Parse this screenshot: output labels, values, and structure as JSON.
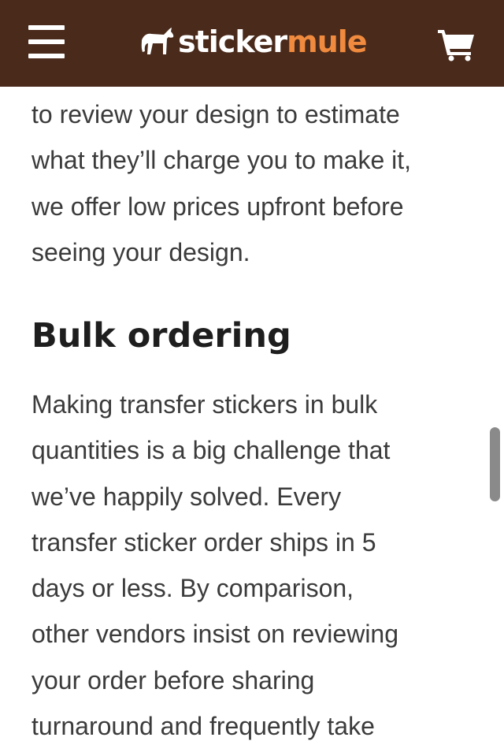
{
  "header": {
    "logo": {
      "part1": "sticker",
      "part2": "mule",
      "color_part1": "#ffffff",
      "color_part2": "#f08a3e"
    },
    "background": "#4a2a1b",
    "icons": {
      "menu": "hamburger-menu-icon",
      "cart": "shopping-cart-icon",
      "logo": "mule-icon"
    }
  },
  "content": {
    "intro_lines": [
      "to review your design to estimate",
      "what they’ll charge you to make it,",
      "we offer low prices upfront before",
      "seeing your design."
    ],
    "heading": "Bulk ordering",
    "body_lines": [
      "Making transfer stickers in bulk",
      "quantities is a big challenge that",
      "we’ve happily solved. Every",
      "transfer sticker order ships in 5",
      "days or less. By comparison,",
      "other vendors insist on reviewing",
      "your order before sharing",
      "turnaround and frequently take"
    ]
  }
}
